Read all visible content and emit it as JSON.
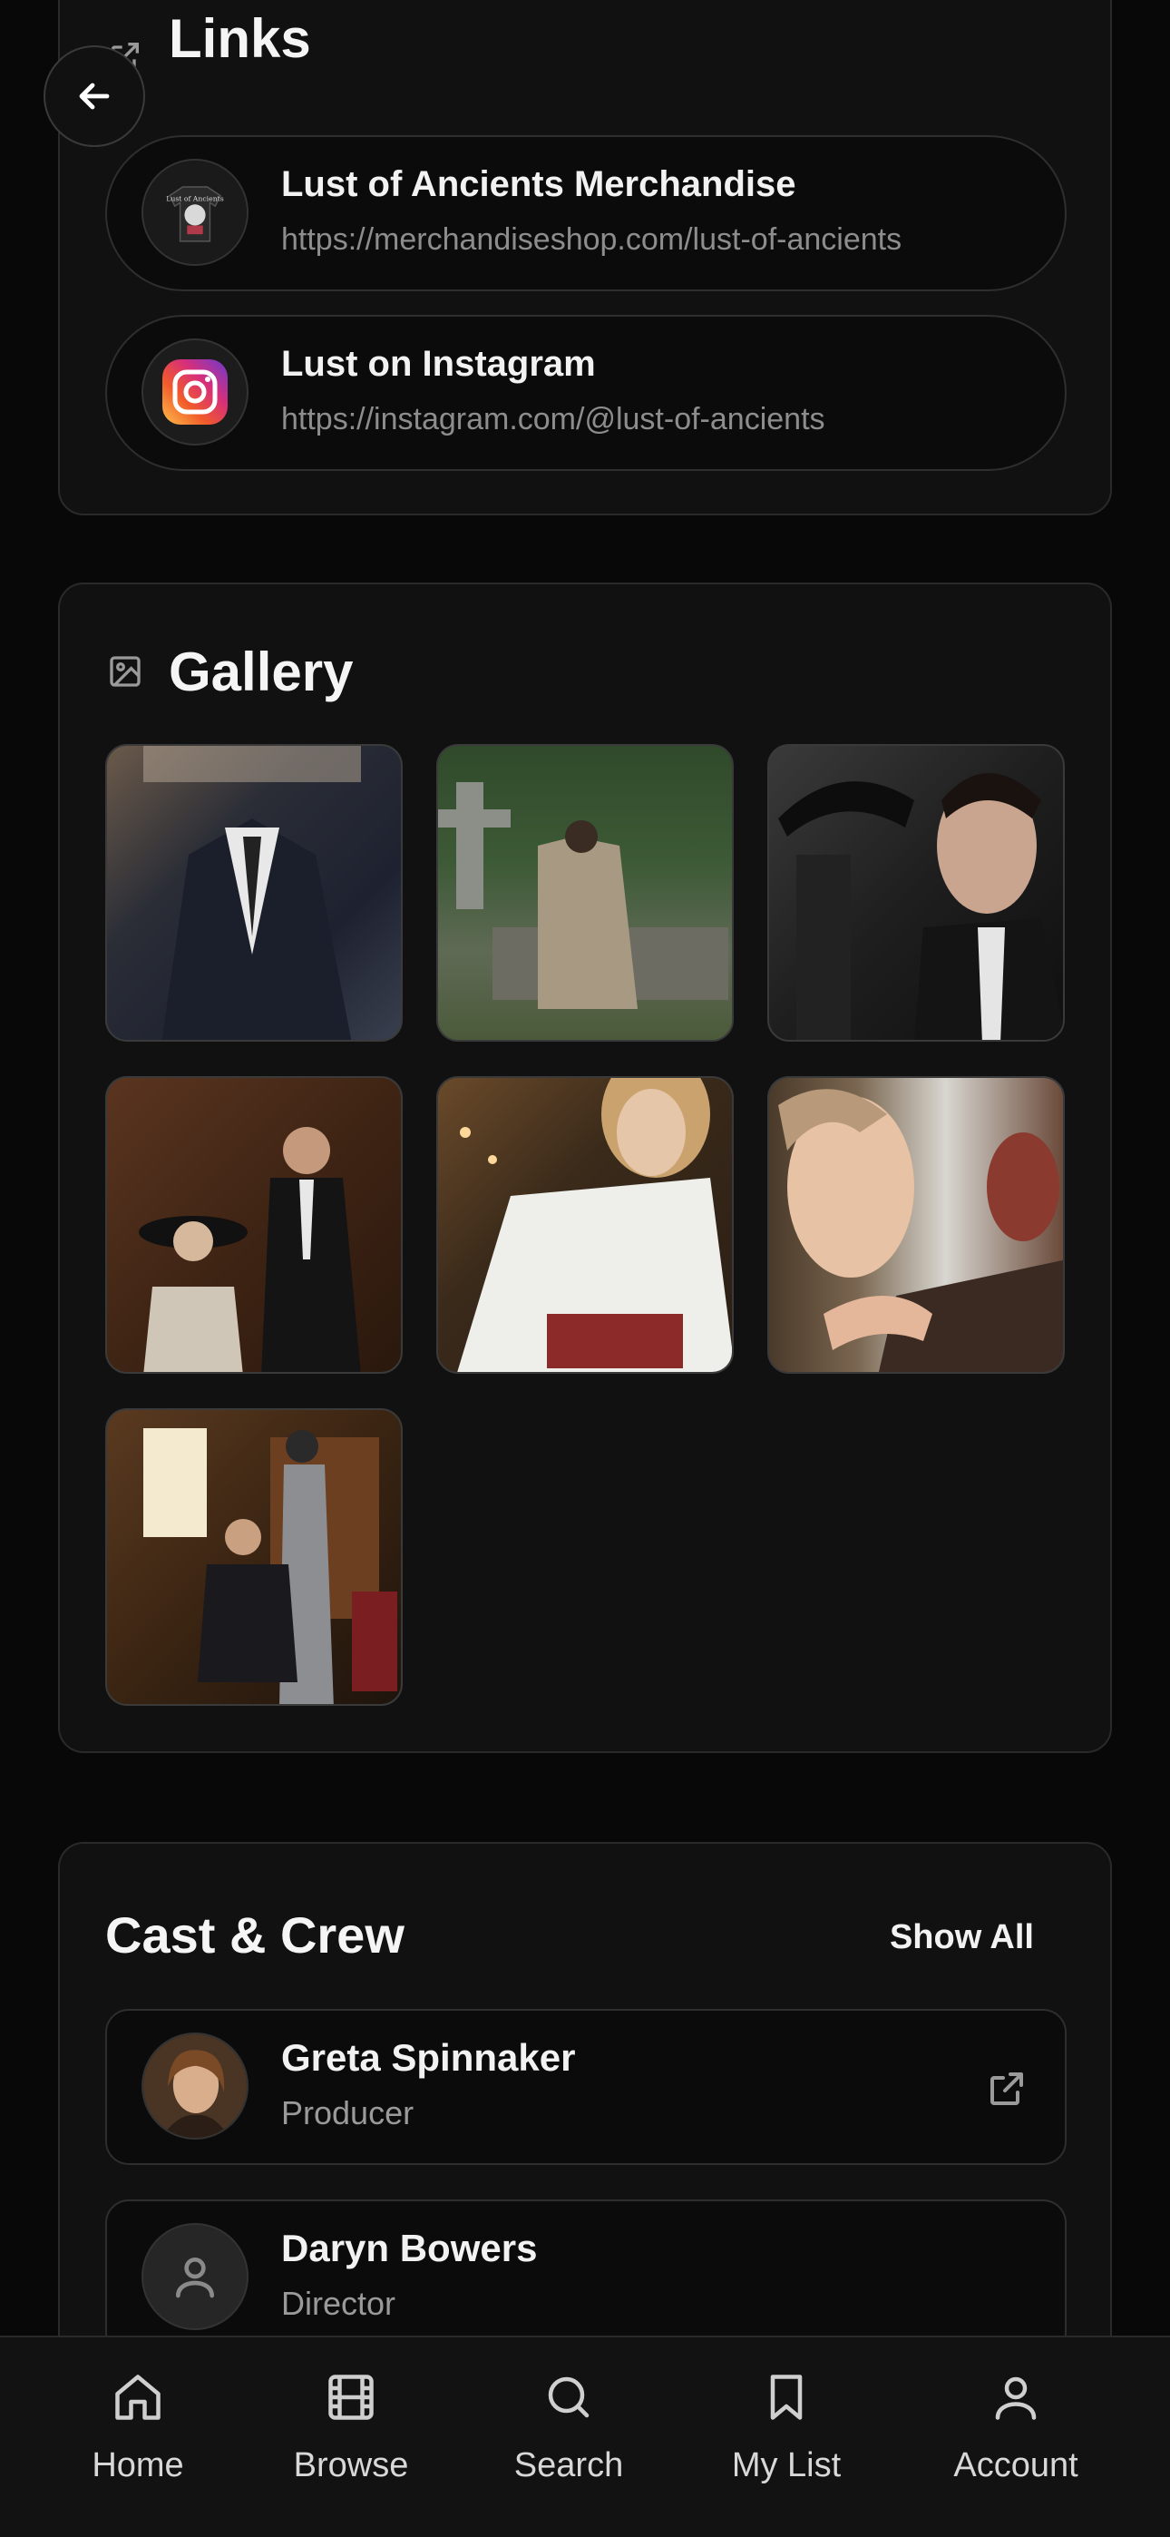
{
  "links_section": {
    "title": "Links",
    "items": [
      {
        "title": "Lust of Ancients Merchandise",
        "url": "https://merchandiseshop.com/lust-of-ancients"
      },
      {
        "title": "Lust on Instagram",
        "url": "https://instagram.com/@lust-of-ancients"
      }
    ]
  },
  "gallery_section": {
    "title": "Gallery",
    "image_count": 7
  },
  "cast_section": {
    "title": "Cast & Crew",
    "show_all_label": "Show All",
    "members": [
      {
        "name": "Greta Spinnaker",
        "role": "Producer"
      },
      {
        "name": "Daryn Bowers",
        "role": "Director"
      }
    ]
  },
  "nav": {
    "items": [
      {
        "label": "Home",
        "icon": "home-icon"
      },
      {
        "label": "Browse",
        "icon": "film-icon"
      },
      {
        "label": "Search",
        "icon": "search-icon"
      },
      {
        "label": "My List",
        "icon": "bookmark-icon"
      },
      {
        "label": "Account",
        "icon": "user-icon"
      }
    ]
  },
  "colors": {
    "background": "#080808",
    "card": "#111111",
    "border": "#2a2a2a",
    "text_primary": "#f2f2f2",
    "text_secondary": "#8d8d8d"
  }
}
